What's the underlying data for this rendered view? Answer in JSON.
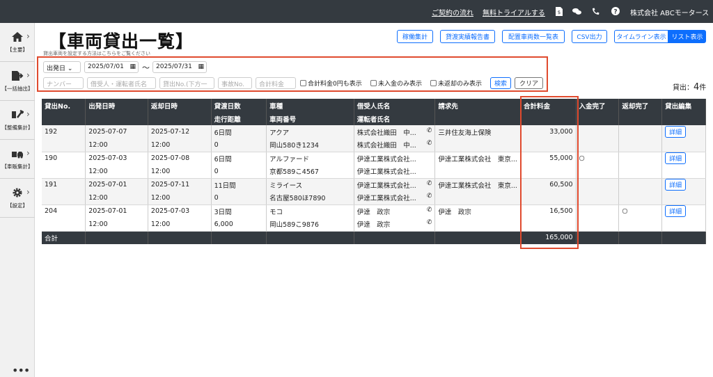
{
  "topbar": {
    "contract_flow": "ご契約の流れ",
    "free_trial": "無料トライアルする",
    "company": "株式会社 ABCモータース",
    "icons": [
      "invoice-icon",
      "chat-icon",
      "phone-icon",
      "help-icon"
    ]
  },
  "sidebar": {
    "items": [
      {
        "label": "【主要】",
        "icon": "home-icon"
      },
      {
        "label": "【一括抽出】",
        "icon": "export-icon"
      },
      {
        "label": "【整備集計】",
        "icon": "tools-icon"
      },
      {
        "label": "【車販集計】",
        "icon": "car-icon"
      },
      {
        "label": "【設定】",
        "icon": "gear-icon"
      }
    ],
    "more": "•••"
  },
  "page": {
    "title": "【車両貸出一覧】",
    "subnote": "貸出車両を設定する方法はこちらをご覧ください"
  },
  "toolbar": {
    "buttons": [
      "稼働集計",
      "貸渡実績報告書",
      "配置車両数一覧表",
      "CSV出力"
    ],
    "view_timeline": "タイムライン表示",
    "view_list": "リスト表示"
  },
  "filters": {
    "date_type": "出発日 ⌄",
    "date_from": "2025/07/01",
    "tilde": "〜",
    "date_to": "2025/07/31",
    "number_ph": "ナンバー",
    "borrower_ph": "借受人・運転者氏名",
    "rental_no_ph": "貸出No.(下方一",
    "accident_no_ph": "事故No.",
    "total_fee_ph": "合計料金",
    "chk_zero": "合計料金0円も表示",
    "chk_unpaid": "未入金のみ表示",
    "chk_unreturned": "未返却のみ表示",
    "search": "検索",
    "clear": "クリア"
  },
  "count": {
    "label": "貸出：",
    "value": "4",
    "unit": "件"
  },
  "table": {
    "headers_row1": [
      "貸出No.",
      "出発日時",
      "返却日時",
      "貸渡日数",
      "車種",
      "借受人氏名",
      "請求先",
      "合計料金",
      "入金完了",
      "返却完了",
      "貸出編集"
    ],
    "headers_row2": [
      "",
      "",
      "",
      "走行距離",
      "車両番号",
      "運転者氏名",
      "",
      "",
      "",
      "",
      ""
    ],
    "rows": [
      {
        "no": "192",
        "dep_date": "2025-07-07",
        "dep_time": "12:00",
        "ret_date": "2025-07-12",
        "ret_time": "12:00",
        "days": "6日間",
        "distance": "0",
        "model": "アクア",
        "plate": "岡山580き1234",
        "borrower": "株式会社織田　中...",
        "driver": "株式会社織田　中...",
        "phone1": true,
        "phone2": true,
        "billing": "三井住友海上保険",
        "total": "33,000",
        "paid": "",
        "returned": "",
        "edit": "詳細"
      },
      {
        "no": "190",
        "dep_date": "2025-07-03",
        "dep_time": "12:00",
        "ret_date": "2025-07-08",
        "ret_time": "12:00",
        "days": "6日間",
        "distance": "0",
        "model": "アルファード",
        "plate": "京都589こ4567",
        "borrower": "伊達工業株式会社...",
        "driver": "伊達工業株式会社...",
        "phone1": false,
        "phone2": false,
        "billing": "伊達工業株式会社　東京...",
        "total": "55,000",
        "paid": "○",
        "returned": "",
        "edit": "詳細"
      },
      {
        "no": "191",
        "dep_date": "2025-07-01",
        "dep_time": "12:00",
        "ret_date": "2025-07-11",
        "ret_time": "12:00",
        "days": "11日間",
        "distance": "0",
        "model": "ミライース",
        "plate": "名古屋580ほ7890",
        "borrower": "伊達工業株式会社...",
        "driver": "伊達工業株式会社...",
        "phone1": true,
        "phone2": true,
        "billing": "伊達工業株式会社　東京...",
        "total": "60,500",
        "paid": "",
        "returned": "",
        "edit": "詳細"
      },
      {
        "no": "204",
        "dep_date": "2025-07-01",
        "dep_time": "12:00",
        "ret_date": "2025-07-03",
        "ret_time": "12:00",
        "days": "3日間",
        "distance": "6,000",
        "model": "モコ",
        "plate": "岡山589こ9876",
        "borrower": "伊達　政宗",
        "driver": "伊達　政宗",
        "phone1": true,
        "phone2": true,
        "billing": "伊達　政宗",
        "total": "16,500",
        "paid": "",
        "returned": "○",
        "edit": "詳細"
      }
    ],
    "footer_label": "合計",
    "footer_total": "165,000"
  }
}
